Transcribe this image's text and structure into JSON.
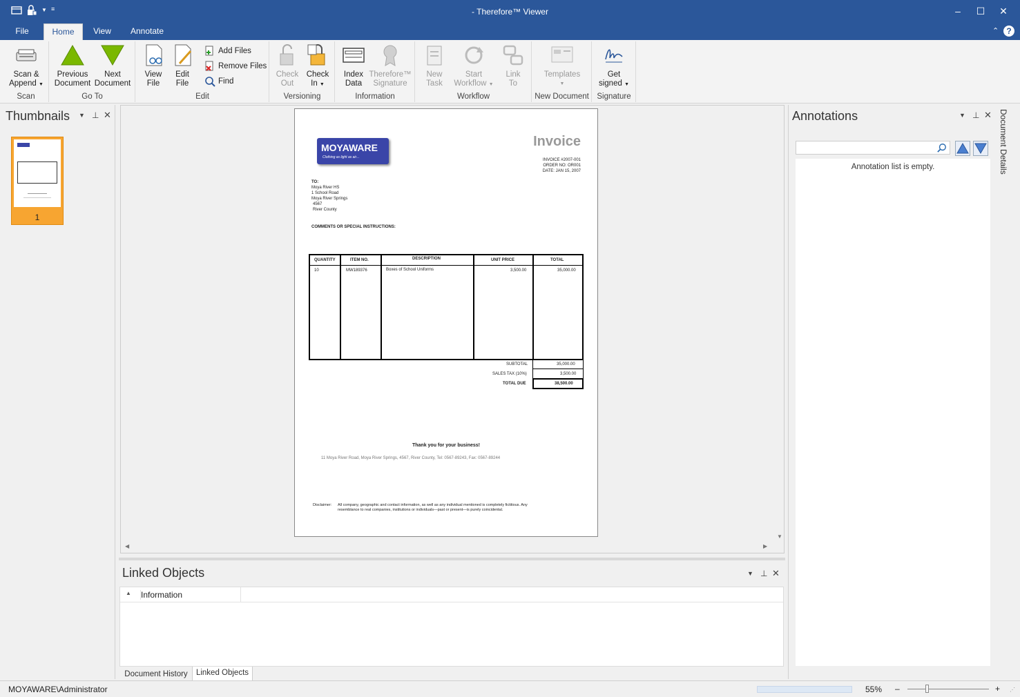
{
  "window": {
    "title": "- Therefore™ Viewer",
    "minimize": "–",
    "maximize": "☐",
    "close": "✕"
  },
  "tabs": [
    {
      "label": "File"
    },
    {
      "label": "Home"
    },
    {
      "label": "View"
    },
    {
      "label": "Annotate"
    }
  ],
  "ribbon": {
    "scan": {
      "line1": "Scan &",
      "line2": "Append",
      "group": "Scan"
    },
    "prev": {
      "line1": "Previous",
      "line2": "Document"
    },
    "next": {
      "line1": "Next",
      "line2": "Document"
    },
    "goto_group": "Go To",
    "view_file": {
      "line1": "View",
      "line2": "File"
    },
    "edit_file": {
      "line1": "Edit",
      "line2": "File"
    },
    "add_files": "Add Files",
    "remove_files": "Remove Files",
    "find": "Find",
    "edit_group": "Edit",
    "check_out": {
      "line1": "Check",
      "line2": "Out"
    },
    "check_in": {
      "line1": "Check",
      "line2": "In"
    },
    "versioning_group": "Versioning",
    "index_data": {
      "line1": "Index",
      "line2": "Data"
    },
    "therefore_sig": {
      "line1": "Therefore™",
      "line2": "Signature"
    },
    "information_group": "Information",
    "new_task": {
      "line1": "New",
      "line2": "Task"
    },
    "start_workflow": {
      "line1": "Start",
      "line2": "Workflow"
    },
    "link_to": {
      "line1": "Link",
      "line2": "To"
    },
    "workflow_group": "Workflow",
    "templates": "Templates",
    "new_document_group": "New Document",
    "get_signed": {
      "line1": "Get",
      "line2": "signed"
    },
    "signature_group": "Signature"
  },
  "thumbnails": {
    "title": "Thumbnails",
    "page_number": "1"
  },
  "invoice": {
    "company": "MOYAWARE",
    "tagline": "Clothing as light as air...",
    "heading": "Invoice",
    "invoice_no": "INVOICE #2007-001",
    "order_no": "ORDER NO: OR001",
    "date": "DATE: JAN 15, 2007",
    "to_label": "TO:",
    "to_lines": [
      "Moya River  HS",
      "1 School Road",
      "Moya River Springs",
      "4567",
      "River County"
    ],
    "comments_label": "COMMENTS OR SPECIAL INSTRUCTIONS:",
    "columns": [
      "QUANTITY",
      "ITEM NO.",
      "DESCRIPTION",
      "UNIT PRICE",
      "TOTAL"
    ],
    "row": {
      "qty": "10",
      "item": "MW189376",
      "desc": "Boxes of School Uniforms",
      "unit": "3,500.00",
      "total": "35,000.00"
    },
    "subtotal_label": "SUBTOTAL",
    "subtotal": "35,000.00",
    "tax_label": "SALES TAX (10%)",
    "tax": "3,500.00",
    "due_label": "TOTAL DUE",
    "due": "38,500.00",
    "thanks": "Thank you for your business!",
    "address": "11 Moya River Road, Moya River Springs, 4567, River County, Tel: 0567-89243, Fax: 0567-89244",
    "disclaimer_label": "Disclaimer:",
    "disclaimer_1": "All company, geographic and contact information, as well as any individual mentioned is completely fictitious.  Any",
    "disclaimer_2": "resemblance to real companies, institutions or individuals—past or present—is purely coincidental."
  },
  "linked_objects": {
    "title": "Linked Objects",
    "column": "Information",
    "tab_history": "Document History",
    "tab_linked": "Linked Objects"
  },
  "annotations": {
    "title": "Annotations",
    "empty": "Annotation list is empty."
  },
  "document_details": "Document Details",
  "status": {
    "user": "MOYAWARE\\Administrator",
    "zoom": "55%",
    "minus": "–",
    "plus": "+"
  },
  "colors": {
    "titlebar": "#2b579a",
    "thumb_selected": "#f7a531",
    "go_arrow": "#7ab800"
  }
}
